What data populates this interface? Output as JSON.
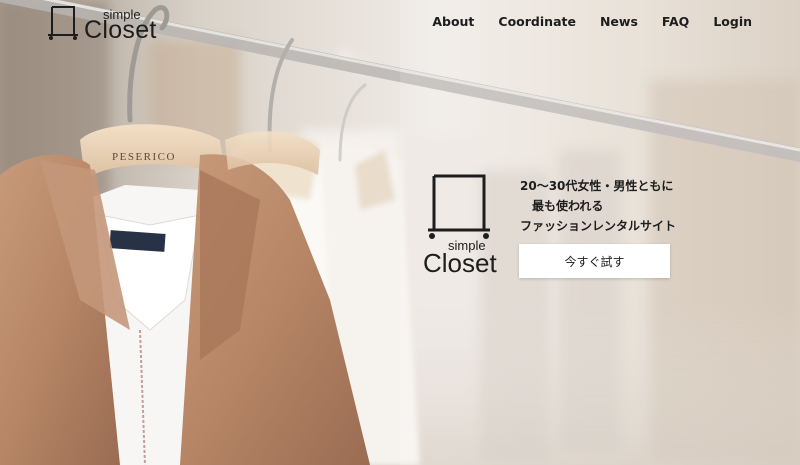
{
  "brand": {
    "simple": "simple",
    "closet": "Closet"
  },
  "nav": {
    "about": "About",
    "coordinate": "Coordinate",
    "news": "News",
    "faq": "FAQ",
    "login": "Login"
  },
  "hero": {
    "tagline_line1": "20〜30代女性・男性ともに",
    "tagline_line2": "最も使われる",
    "tagline_line3": "ファッションレンタルサイト",
    "cta_label": "今すぐ試す",
    "hanger_brand": "PESERICO"
  },
  "colors": {
    "text": "#1d1d1d",
    "button_bg": "#ffffff",
    "coat": "#b68566"
  },
  "icons": {
    "logo": "clothes-rack-icon"
  }
}
